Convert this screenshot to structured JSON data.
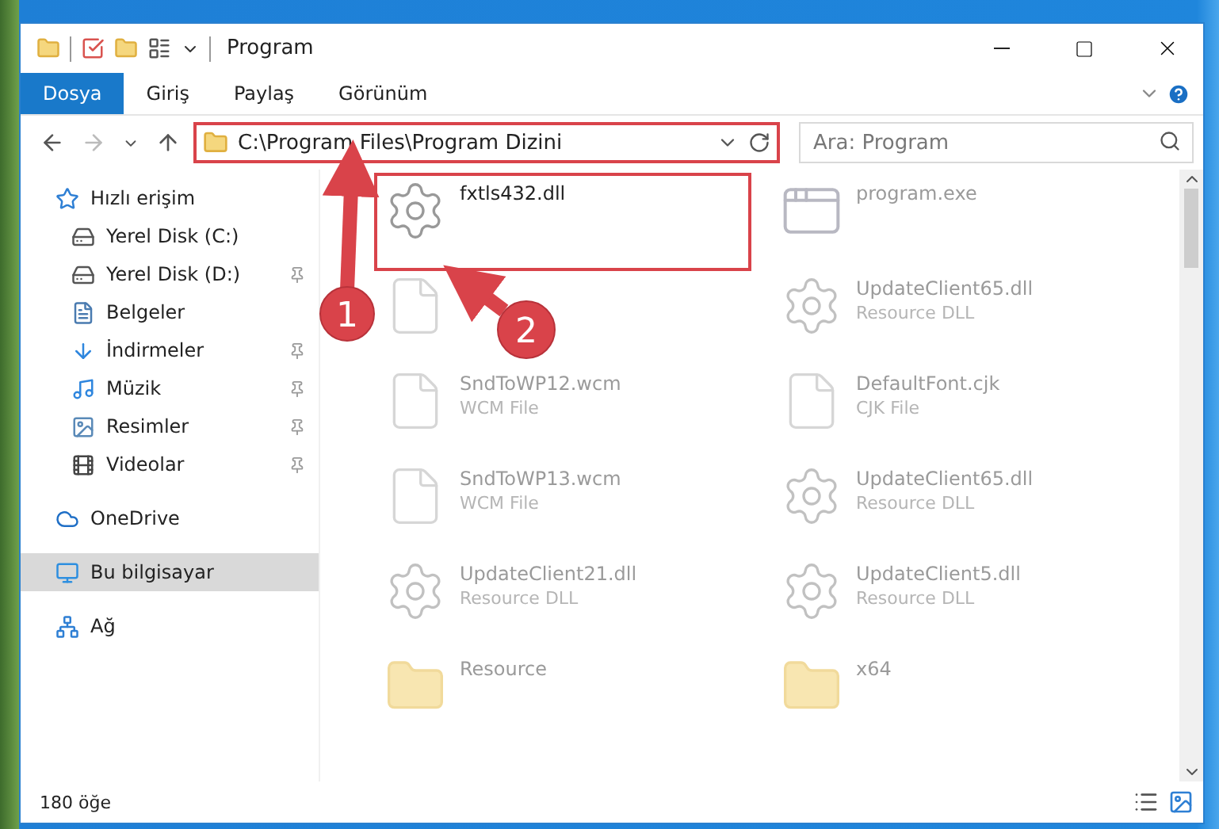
{
  "window": {
    "title": "Program"
  },
  "ribbon_tabs": [
    {
      "label": "Dosya",
      "selected": true
    },
    {
      "label": "Giriş",
      "selected": false
    },
    {
      "label": "Paylaş",
      "selected": false
    },
    {
      "label": "Görünüm",
      "selected": false
    }
  ],
  "address": {
    "path": "C:\\Program Files\\Program Dizini",
    "highlighted": true
  },
  "search": {
    "placeholder": "Ara: Program"
  },
  "sidebar": {
    "items": [
      {
        "label": "Hızlı erişim",
        "kind": "star",
        "selected": false,
        "children": [
          {
            "label": "Yerel Disk (C:)",
            "kind": "disk",
            "selected": false,
            "pinned": false
          },
          {
            "label": "Yerel Disk (D:)",
            "kind": "disk",
            "selected": false,
            "pinned": true
          },
          {
            "label": "Belgeler",
            "kind": "document",
            "selected": false,
            "pinned": false
          },
          {
            "label": "İndirmeler",
            "kind": "download",
            "selected": false,
            "pinned": true
          },
          {
            "label": "Müzik",
            "kind": "music",
            "selected": false,
            "pinned": true
          },
          {
            "label": "Resimler",
            "kind": "picture",
            "selected": false,
            "pinned": true
          },
          {
            "label": "Videolar",
            "kind": "video",
            "selected": false,
            "pinned": true
          }
        ]
      },
      {
        "label": "OneDrive",
        "kind": "cloud",
        "selected": false
      },
      {
        "label": "Bu bilgisayar",
        "kind": "computer",
        "selected": true
      },
      {
        "label": "Ağ",
        "kind": "network",
        "selected": false
      }
    ]
  },
  "files": [
    {
      "name": "fxtls432.dll",
      "kind": "gear-file",
      "highlighted": true,
      "dimmed": false
    },
    {
      "name": "program.exe",
      "kind": "app",
      "highlighted": false,
      "dimmed": true
    },
    {
      "kind": "file",
      "highlighted": false,
      "dimmed": true
    },
    {
      "name": "UpdateClient65.dll",
      "type": "Resource DLL",
      "kind": "gear-file",
      "highlighted": false,
      "dimmed": true
    },
    {
      "name": "SndToWP12.wcm",
      "type": "WCM File",
      "kind": "file",
      "highlighted": false,
      "dimmed": true
    },
    {
      "name": "DefaultFont.cjk",
      "type": "CJK File",
      "kind": "file",
      "highlighted": false,
      "dimmed": true
    },
    {
      "name": "SndToWP13.wcm",
      "type": "WCM File",
      "kind": "file",
      "highlighted": false,
      "dimmed": true
    },
    {
      "name": "UpdateClient65.dll",
      "type": "Resource DLL",
      "kind": "gear-file",
      "highlighted": false,
      "dimmed": true
    },
    {
      "name": "UpdateClient21.dll",
      "type": "Resource DLL",
      "kind": "gear-file",
      "highlighted": false,
      "dimmed": true
    },
    {
      "name": "UpdateClient5.dll",
      "type": "Resource DLL",
      "kind": "gear-file",
      "highlighted": false,
      "dimmed": true
    },
    {
      "name": "Resource",
      "kind": "folder",
      "highlighted": false,
      "dimmed": true
    },
    {
      "name": "x64",
      "kind": "folder",
      "highlighted": false,
      "dimmed": true
    }
  ],
  "status_bar": {
    "item_count": "180 öğe"
  },
  "annotations": [
    {
      "label": "1"
    },
    {
      "label": "2"
    }
  ]
}
